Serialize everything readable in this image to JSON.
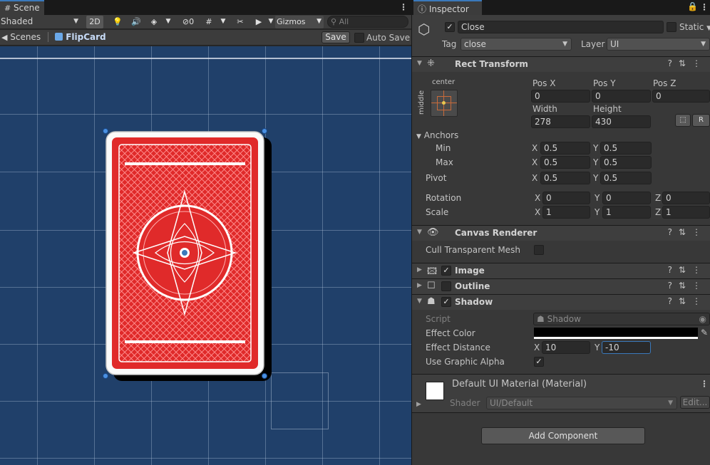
{
  "scene": {
    "tab_label": "Scene",
    "toolbar": {
      "shading_mode": "Shaded",
      "mode_2d": "2D",
      "hidden_count": "0",
      "gizmos_label": "Gizmos",
      "search_placeholder": "All"
    },
    "breadcrumb": {
      "scenes_label": "Scenes",
      "prefab_label": "FlipCard",
      "save_label": "Save",
      "auto_save_label": "Auto Save"
    }
  },
  "inspector": {
    "tab_label": "Inspector",
    "object": {
      "name": "Close",
      "active": true,
      "static_label": "Static",
      "tag_label": "Tag",
      "tag_value": "close",
      "layer_label": "Layer",
      "layer_value": "UI"
    },
    "rect_transform": {
      "title": "Rect Transform",
      "anchor_preset_top": "center",
      "anchor_preset_side": "middle",
      "pos_x_label": "Pos X",
      "pos_y_label": "Pos Y",
      "pos_z_label": "Pos Z",
      "pos_x": "0",
      "pos_y": "0",
      "pos_z": "0",
      "width_label": "Width",
      "height_label": "Height",
      "width": "278",
      "height": "430",
      "raw_button": "R",
      "anchors_label": "Anchors",
      "min_label": "Min",
      "max_label": "Max",
      "anchor_min_x": "0.5",
      "anchor_min_y": "0.5",
      "anchor_max_x": "0.5",
      "anchor_max_y": "0.5",
      "pivot_label": "Pivot",
      "pivot_x": "0.5",
      "pivot_y": "0.5",
      "rotation_label": "Rotation",
      "rot_x": "0",
      "rot_y": "0",
      "rot_z": "0",
      "scale_label": "Scale",
      "scale_x": "1",
      "scale_y": "1",
      "scale_z": "1",
      "x": "X",
      "y": "Y",
      "z": "Z"
    },
    "canvas_renderer": {
      "title": "Canvas Renderer",
      "cull_label": "Cull Transparent Mesh"
    },
    "image": {
      "title": "Image"
    },
    "outline": {
      "title": "Outline"
    },
    "shadow": {
      "title": "Shadow",
      "script_label": "Script",
      "script_value": "Shadow",
      "effect_color_label": "Effect Color",
      "effect_color": "#000000",
      "effect_distance_label": "Effect Distance",
      "dist_x": "10",
      "dist_y": "-10",
      "use_alpha_label": "Use Graphic Alpha"
    },
    "material": {
      "name": "Default UI Material (Material)",
      "shader_label": "Shader",
      "shader_value": "UI/Default",
      "edit_label": "Edit..."
    },
    "add_component_label": "Add Component"
  },
  "colors": {
    "viewport_bg": "#20406a",
    "card_red": "#e02a2a",
    "selection_blue": "#3a79bb"
  }
}
